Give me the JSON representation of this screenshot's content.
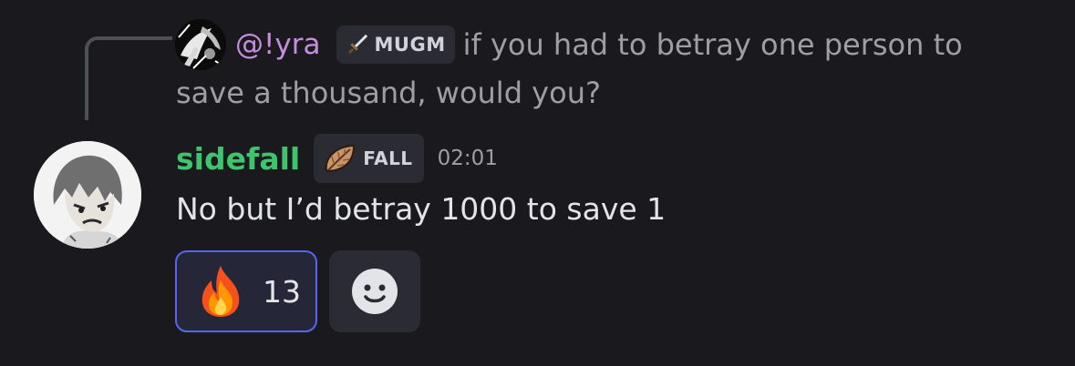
{
  "reply": {
    "author": "@!yra",
    "tag": "MUGM",
    "tag_icon": "sword-icon",
    "text_inline": "if you had to betray one person to",
    "text_wrap": "save a thousand, would you?"
  },
  "message": {
    "username": "sidefall",
    "tag": "FALL",
    "tag_icon": "leaf-icon",
    "timestamp": "02:01",
    "text": "No but I’d betray 1000 to save 1"
  },
  "reactions": [
    {
      "emoji": "fire-icon",
      "count": "13",
      "reacted_by_me": true
    }
  ],
  "add_reaction_icon": "smiley-icon",
  "colors": {
    "background": "#1a1a1e",
    "reply_author": "#c58fe0",
    "username": "#3ec46b",
    "accent": "#5865f2"
  }
}
